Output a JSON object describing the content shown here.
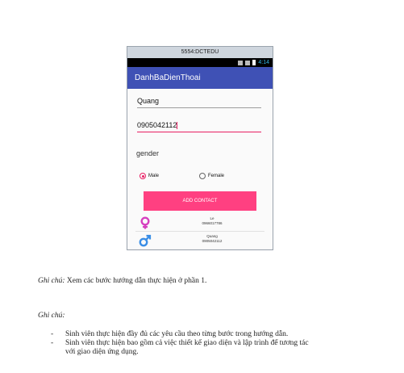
{
  "emulator": {
    "window_title": "5554:DCTEDU",
    "status_time": "4:14",
    "app_title": "DanhBaDienThoai",
    "name_value": "Quang",
    "phone_value": "0905042112",
    "gender_label": "gender",
    "radio_male": "Male",
    "radio_female": "Female",
    "add_button": "ADD CONTACT",
    "contacts": [
      {
        "name": "Le",
        "phone": "0966017786",
        "icon": "female-symbol-icon",
        "color": "#d63fbf"
      },
      {
        "name": "Quang",
        "phone": "0905042112",
        "icon": "male-symbol-icon",
        "color": "#3a8ee6"
      }
    ]
  },
  "document": {
    "note1_label": "Ghi chú:",
    "note1_text": " Xem các bước hướng dẫn thực hiện ở phần 1.",
    "note2_label": "Ghi chú:",
    "bullets": [
      {
        "dash": "-",
        "text": "Sinh viên thực hiện đầy đủ các yêu cầu theo từng bước trong hướng dẫn."
      },
      {
        "dash": "-",
        "text": "Sinh viên thực hiện bao gồm cả việc thiết kế giao diện và lập trình để tương tác"
      },
      {
        "dash": "",
        "text": "với giao diện ứng dụng."
      }
    ]
  }
}
